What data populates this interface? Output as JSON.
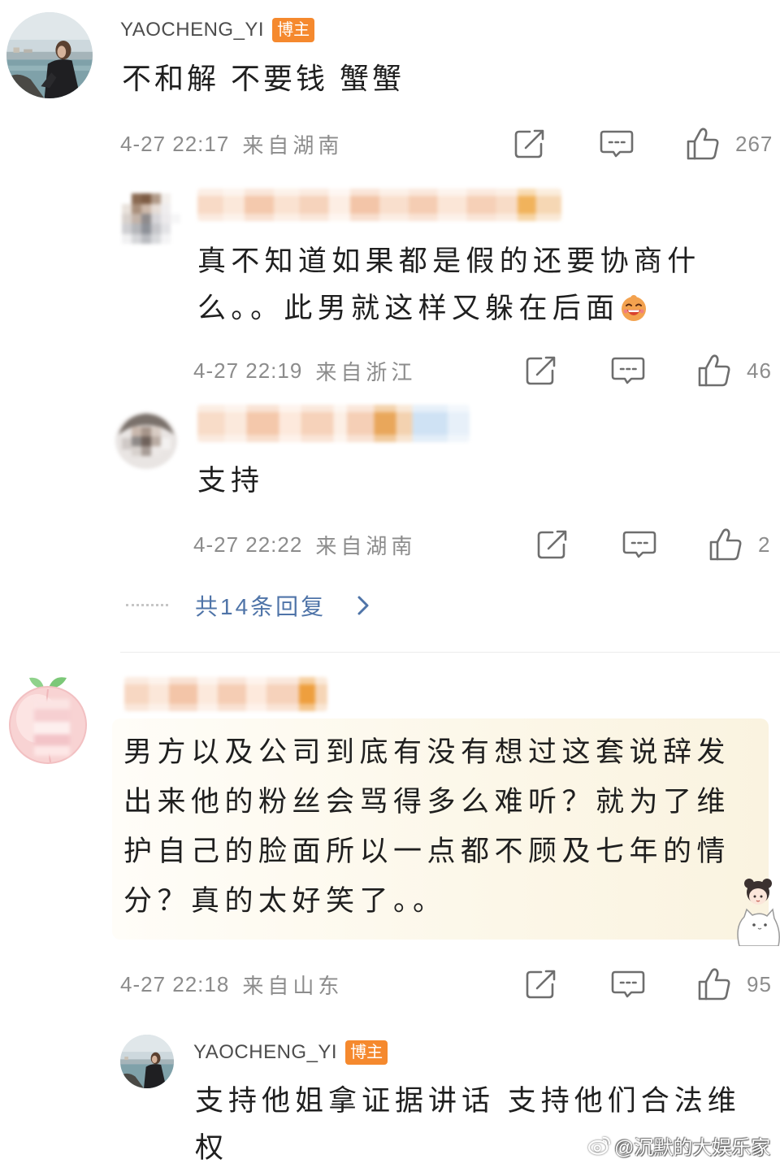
{
  "colors": {
    "text": "#1f1f1f",
    "meta_text": "#8c8c8c",
    "username": "#4d4d4d",
    "badge_background": "#f5892e",
    "badge_text": "#ffffff",
    "link": "#4f74a8",
    "icon_stroke": "#6e6e6e",
    "card_background": "#fcf7e8",
    "divider": "#ececec"
  },
  "comments": [
    {
      "user": {
        "name": "YAOCHENG_YI",
        "badge": "博主"
      },
      "text": "不和解 不要钱 蟹蟹",
      "time": "4-27 22:17",
      "location": "来自湖南",
      "likes": "267",
      "replies": [
        {
          "text": "真不知道如果都是假的还要协商什么。。此男就这样又躲在后面",
          "time": "4-27 22:19",
          "location": "来自浙江",
          "likes": "46"
        },
        {
          "text": "支持",
          "time": "4-27 22:22",
          "location": "来自湖南",
          "likes": "2"
        }
      ],
      "more_replies": "共14条回复"
    },
    {
      "text": "男方以及公司到底有没有想过这套说辞发出来他的粉丝会骂得多么难听？就为了维护自己的脸面所以一点都不顾及七年的情分？真的太好笑了。。",
      "time": "4-27 22:18",
      "location": "来自山东",
      "likes": "95",
      "replies": [
        {
          "user": {
            "name": "YAOCHENG_YI",
            "badge": "博主"
          },
          "text": "支持他姐拿证据讲话 支持他们合法维权"
        }
      ]
    }
  ],
  "icons": {
    "share": "share-icon",
    "comment": "comment-icon",
    "like": "thumbs-up-icon",
    "more_replies": "chevron-right-icon",
    "reply_emoji": "laugh-emoji-icon",
    "watermark_logo": "weibo-logo-icon"
  },
  "watermark": "@沉默的大娱乐家"
}
